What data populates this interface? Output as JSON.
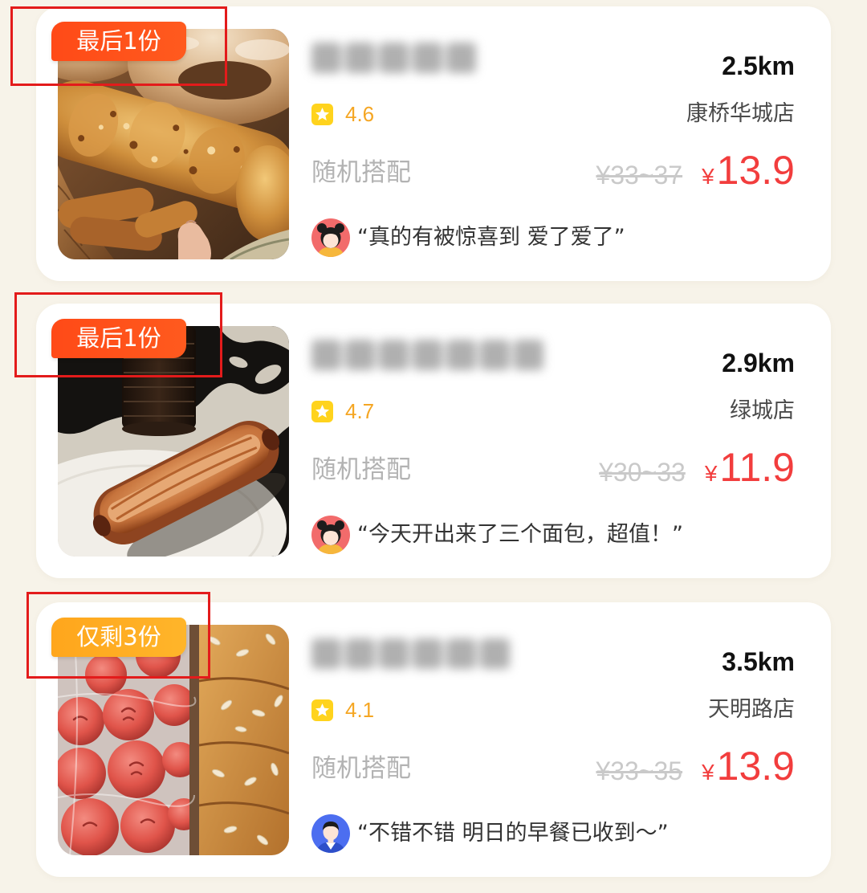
{
  "colors": {
    "page_background": "#f7f3e9",
    "card_background": "#ffffff",
    "price": "#f23d3d",
    "rating": "#f5a623",
    "star_badge": "#ffd31d",
    "original_price": "#c9c9c9",
    "highlight_box": "#e31b1b"
  },
  "rating_icon": "star-icon",
  "cards": [
    {
      "badge": "最后1份",
      "badge_color": "#ff5219",
      "distance": "2.5km",
      "rating": "4.6",
      "branch": "康桥华城店",
      "description": "随机搭配",
      "original_price": "¥33~37",
      "price_currency": "¥",
      "price": "13.9",
      "review": "“真的有被惊喜到 爱了爱了”",
      "avatar_icon": "girl-avatar-icon"
    },
    {
      "badge": "最后1份",
      "badge_color": "#ff5219",
      "distance": "2.9km",
      "rating": "4.7",
      "branch": "绿城店",
      "description": "随机搭配",
      "original_price": "¥30~33",
      "price_currency": "¥",
      "price": "11.9",
      "review": "“今天开出来了三个面包，超值！”",
      "avatar_icon": "girl-avatar-icon"
    },
    {
      "badge": "仅剩3份",
      "badge_color": "#ffab22",
      "distance": "3.5km",
      "rating": "4.1",
      "branch": "天明路店",
      "description": "随机搭配",
      "original_price": "¥33~35",
      "price_currency": "¥",
      "price": "13.9",
      "review": "“不错不错 明日的早餐已收到～”",
      "avatar_icon": "boy-avatar-icon"
    }
  ]
}
